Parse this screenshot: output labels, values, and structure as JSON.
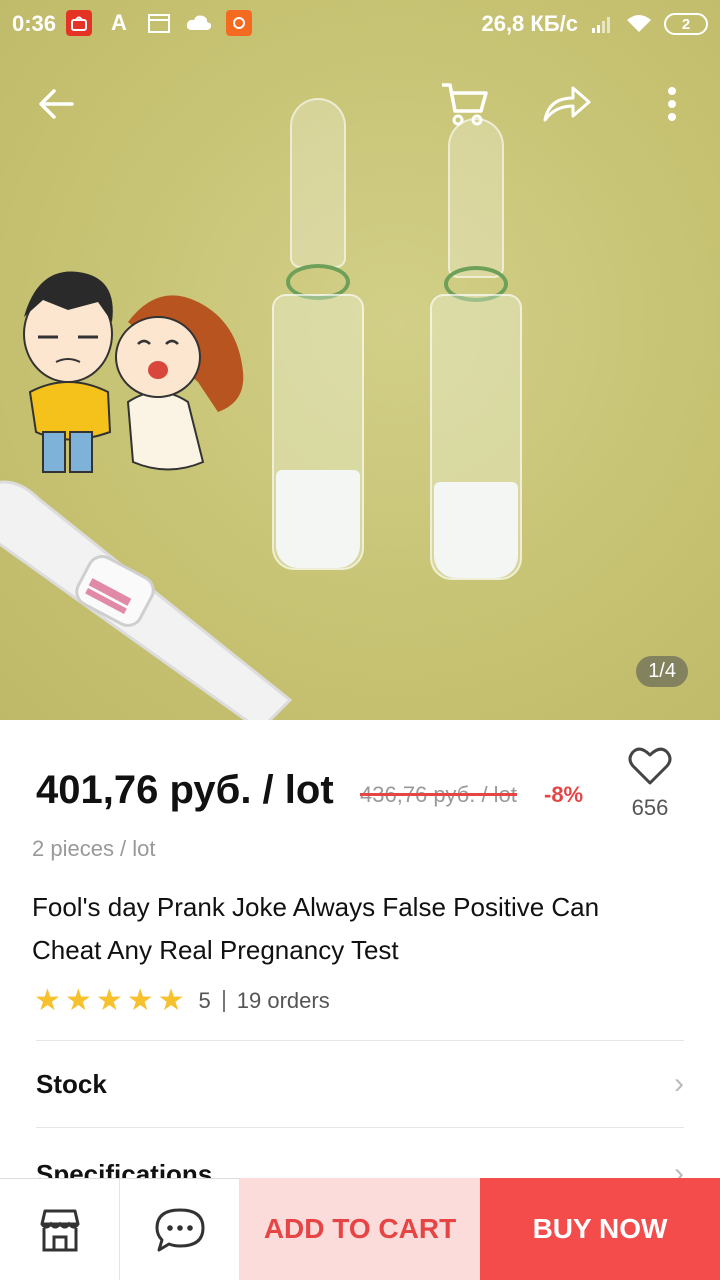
{
  "status_bar": {
    "time": "0:36",
    "network_speed": "26,8 КБ/с",
    "battery": "2",
    "app_icons": [
      "aliexpress-icon",
      "font-a-icon",
      "calendar-icon",
      "cloud-icon",
      "orange-app-icon"
    ]
  },
  "top_nav": {
    "icons": [
      "back-arrow-icon",
      "cart-icon",
      "share-icon",
      "more-vert-icon"
    ]
  },
  "gallery": {
    "counter": "1/4"
  },
  "product": {
    "price": "401,76 руб. / lot",
    "old_price": "436,76 руб. / lot",
    "discount": "-8%",
    "wishlist_count": "656",
    "pieces": "2 pieces / lot",
    "title": "Fool's day Prank Joke Always False Positive Can Cheat Any Real Pregnancy Test",
    "rating": "5",
    "rating_stars": 5,
    "orders": "19 orders"
  },
  "sections": [
    {
      "label": "Stock"
    },
    {
      "label": "Specifications"
    }
  ],
  "bottom_bar": {
    "store_icon": "store-icon",
    "chat_icon": "chat-icon",
    "add_to_cart": "ADD TO CART",
    "buy_now": "BUY NOW"
  },
  "colors": {
    "accent": "#f44b4b",
    "accent_light": "#fcdcdb",
    "star": "#f7c12e"
  }
}
